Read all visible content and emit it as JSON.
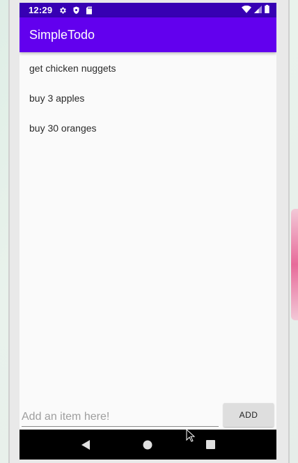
{
  "status_bar": {
    "time": "12:29",
    "left_icons": [
      "gear-icon",
      "shield-icon",
      "sd-card-icon"
    ],
    "right_icons": [
      "wifi-icon",
      "signal-icon",
      "battery-icon"
    ],
    "background": "#3700b3"
  },
  "app_bar": {
    "title": "SimpleTodo",
    "background": "#6200ee"
  },
  "todo_items": [
    "get chicken nuggets",
    "buy 3 apples",
    "buy 30 oranges"
  ],
  "input": {
    "placeholder": "Add an item here!",
    "value": ""
  },
  "add_button": {
    "label": "ADD"
  },
  "nav_bar": {
    "buttons": [
      "back-icon",
      "home-icon",
      "recents-icon"
    ]
  }
}
